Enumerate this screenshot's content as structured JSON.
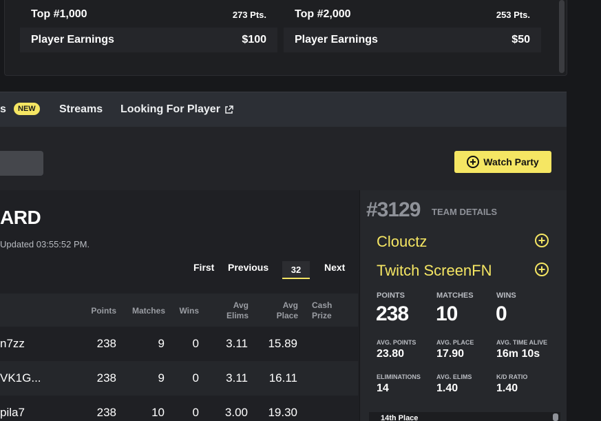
{
  "payout": {
    "left": {
      "title": "Top #1,000",
      "points": "273 Pts.",
      "earn_label": "Player Earnings",
      "earn_value": "$100"
    },
    "right": {
      "title": "Top #2,000",
      "points": "253 Pts.",
      "earn_label": "Player Earnings",
      "earn_value": "$50"
    }
  },
  "tabs": {
    "partial_label": "s",
    "new_badge": "NEW",
    "streams": "Streams",
    "looking": "Looking For Player"
  },
  "actions": {
    "watch_party": "Watch Party"
  },
  "board": {
    "title": "ARD",
    "updated": "Updated 03:55:52 PM.",
    "pager": {
      "first": "First",
      "previous": "Previous",
      "page": "32",
      "next": "Next"
    },
    "columns": [
      "Points",
      "Matches",
      "Wins",
      "Avg Elims",
      "Avg Place",
      "Cash Prize"
    ],
    "rows": [
      {
        "name": "n7zz",
        "points": "238",
        "matches": "9",
        "wins": "0",
        "elims": "3.11",
        "place": "15.89",
        "prize": ""
      },
      {
        "name": "VK1G...",
        "points": "238",
        "matches": "9",
        "wins": "0",
        "elims": "3.11",
        "place": "16.11",
        "prize": ""
      },
      {
        "name": "pila7",
        "points": "238",
        "matches": "10",
        "wins": "0",
        "elims": "3.00",
        "place": "19.30",
        "prize": ""
      }
    ]
  },
  "team": {
    "rank": "#3129",
    "details_label": "TEAM DETAILS",
    "members": [
      "Clouctz",
      "Twitch ScreenFN"
    ],
    "stats": {
      "points_label": "POINTS",
      "points": "238",
      "matches_label": "MATCHES",
      "matches": "10",
      "wins_label": "WINS",
      "wins": "0",
      "avg_points_label": "AVG. POINTS",
      "avg_points": "23.80",
      "avg_place_label": "AVG. PLACE",
      "avg_place": "17.90",
      "avg_time_label": "AVG. TIME ALIVE",
      "avg_time": "16m 10s",
      "elims_label": "ELIMINATIONS",
      "elims": "14",
      "avg_elims_label": "AVG. ELIMS",
      "avg_elims": "1.40",
      "kd_label": "K/D RATIO",
      "kd": "1.40"
    },
    "bottom_partial": "14th Place"
  },
  "colors": {
    "accent": "#f5e663",
    "panel": "#26282c",
    "background": "#17181b"
  }
}
